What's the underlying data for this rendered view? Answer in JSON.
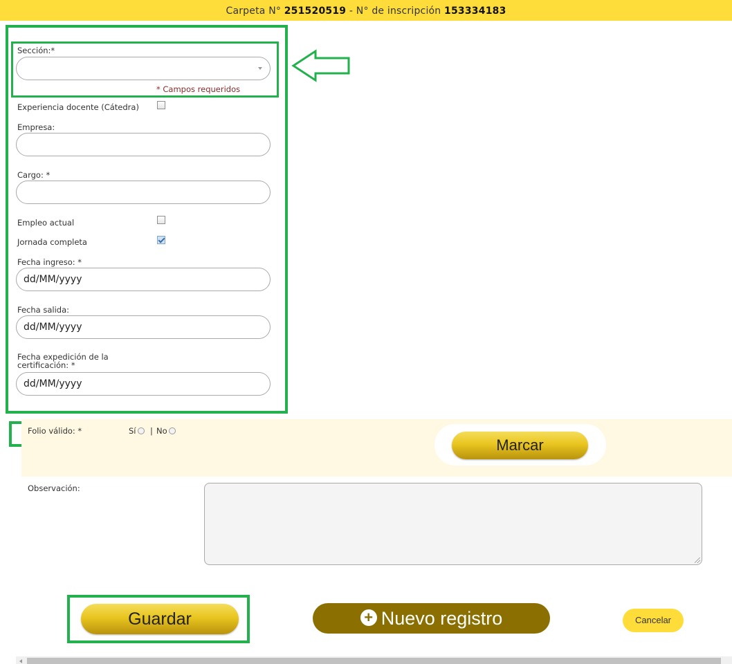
{
  "header": {
    "carpeta_label": "Carpeta N°",
    "carpeta_number": "251520519",
    "separator": "-",
    "inscripcion_label": "N° de inscripción",
    "inscripcion_number": "153334183"
  },
  "form": {
    "seccion_label": "Sección:*",
    "seccion_value": "",
    "required_note": "* Campos requeridos",
    "experiencia_docente_label": "Experiencia docente (Cátedra)",
    "experiencia_docente_checked": false,
    "empresa_label": "Empresa:",
    "empresa_value": "",
    "cargo_label": "Cargo: *",
    "cargo_value": "",
    "empleo_actual_label": "Empleo actual",
    "empleo_actual_checked": false,
    "jornada_completa_label": "Jornada completa",
    "jornada_completa_checked": true,
    "fecha_ingreso_label": "Fecha ingreso: *",
    "fecha_ingreso_placeholder": "dd/MM/yyyy",
    "fecha_salida_label": "Fecha salida:",
    "fecha_salida_placeholder": "dd/MM/yyyy",
    "fecha_expedicion_label_line1": "Fecha expedición de la",
    "fecha_expedicion_label_line2": "certificación: *",
    "fecha_expedicion_placeholder": "dd/MM/yyyy"
  },
  "folio": {
    "label": "Folio válido: *",
    "option_si": "Sí",
    "divider": "|",
    "option_no": "No",
    "marcar_button": "Marcar"
  },
  "observacion": {
    "label": "Observación:",
    "value": ""
  },
  "actions": {
    "guardar": "Guardar",
    "nuevo_registro": "Nuevo registro",
    "cancelar": "Cancelar"
  },
  "colors": {
    "header_bg": "#fedd3a",
    "highlight_green": "#22b14c",
    "gold_button": "#e9c51f",
    "brown_button": "#8b6f00",
    "folio_band": "#fff8e3"
  },
  "icons": {
    "arrow": "left-arrow-outline-icon",
    "plus": "plus-circle-icon",
    "dropdown": "dropdown-arrow-icon"
  }
}
